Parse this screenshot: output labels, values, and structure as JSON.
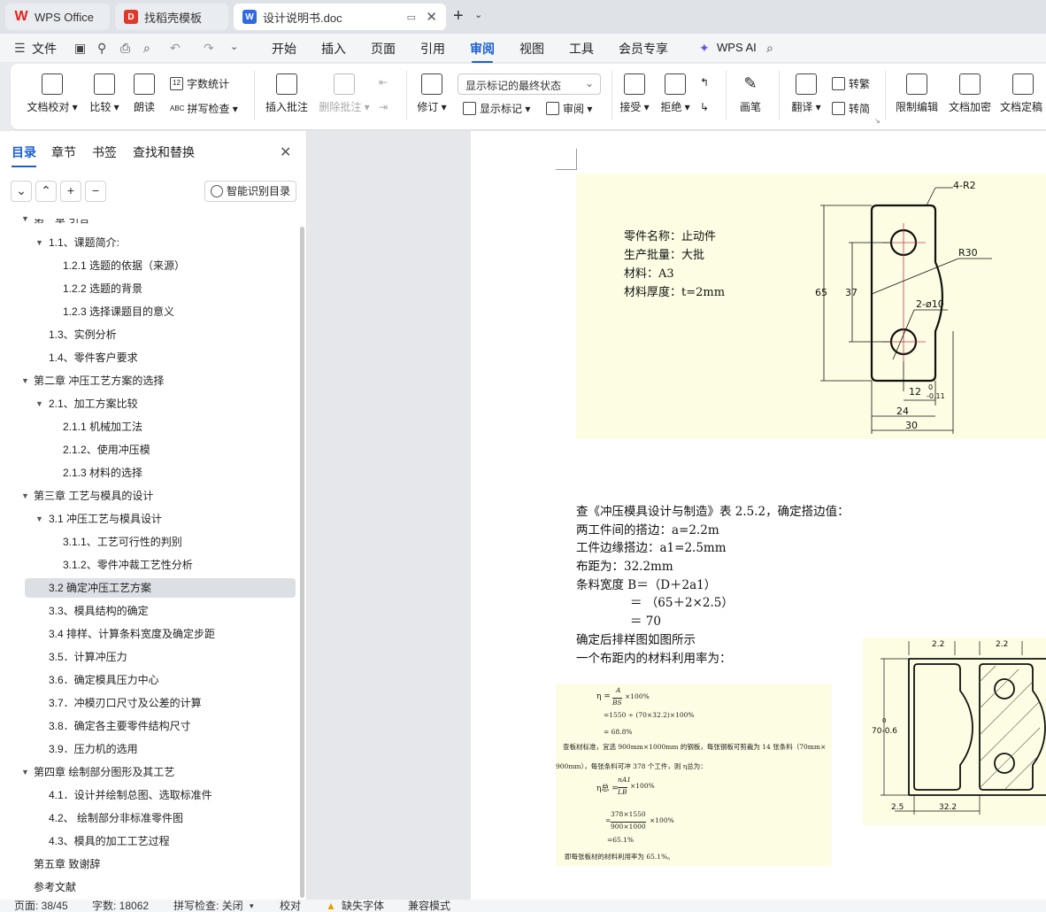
{
  "tabs": {
    "wps": "WPS Office",
    "template": "找稻壳模板",
    "doc": "设计说明书.doc"
  },
  "menu": {
    "file": "文件",
    "items": [
      "开始",
      "插入",
      "页面",
      "引用",
      "审阅",
      "视图",
      "工具",
      "会员专享"
    ],
    "active": "审阅",
    "ai": "WPS AI"
  },
  "ribbon": {
    "doc_check": "文档校对",
    "compare": "比较",
    "read_aloud": "朗读",
    "word_count": "字数统计",
    "spell_check": "拼写检查",
    "insert_comment": "插入批注",
    "delete_comment": "删除批注",
    "revise": "修订",
    "markup_select": "显示标记的最终状态",
    "show_markup": "显示标记",
    "review": "审阅",
    "accept": "接受",
    "reject": "拒绝",
    "pen": "画笔",
    "translate": "翻译",
    "to_traditional": "转繁",
    "to_simplified": "转简",
    "restrict_edit": "限制编辑",
    "doc_encrypt": "文档加密",
    "doc_finalize": "文档定稿"
  },
  "panel": {
    "tabs": [
      "目录",
      "章节",
      "书签",
      "查找和替换"
    ],
    "smart_toc": "智能识别目录",
    "toc": [
      {
        "text": "第一章    引言",
        "level": 0,
        "toggle": true,
        "cut": true
      },
      {
        "text": "1.1、课题简介:",
        "level": 1,
        "toggle": true
      },
      {
        "text": "1.2.1 选题的依据（来源）",
        "level": 2
      },
      {
        "text": "1.2.2 选题的背景",
        "level": 2
      },
      {
        "text": "1.2.3 选择课题目的意义",
        "level": 2
      },
      {
        "text": "1.3、实例分析",
        "level": 1
      },
      {
        "text": "1.4、零件客户要求",
        "level": 1
      },
      {
        "text": "第二章   冲压工艺方案的选择",
        "level": 0,
        "toggle": true
      },
      {
        "text": "2.1、加工方案比较",
        "level": 1,
        "toggle": true
      },
      {
        "text": "2.1.1 机械加工法",
        "level": 2
      },
      {
        "text": "2.1.2、使用冲压模",
        "level": 2
      },
      {
        "text": "2.1.3 材料的选择",
        "level": 2
      },
      {
        "text": "第三章  工艺与模具的设计",
        "level": 0,
        "toggle": true
      },
      {
        "text": "3.1 冲压工艺与模具设计",
        "level": 1,
        "toggle": true
      },
      {
        "text": "3.1.1、工艺可行性的判别",
        "level": 2
      },
      {
        "text": "3.1.2、零件冲裁工艺性分析",
        "level": 2
      },
      {
        "text": "3.2 确定冲压工艺方案",
        "level": 1,
        "selected": true
      },
      {
        "text": "3.3、模具结构的确定",
        "level": 1
      },
      {
        "text": " 3.4 排样、计算条料宽度及确定步距",
        "level": 1
      },
      {
        "text": "3.5．计算冲压力",
        "level": 1
      },
      {
        "text": "3.6．确定模具压力中心",
        "level": 1
      },
      {
        "text": "3.7．冲模刃口尺寸及公差的计算",
        "level": 1
      },
      {
        "text": "3.8．确定各主要零件结构尺寸",
        "level": 1
      },
      {
        "text": "3.9．压力机的选用",
        "level": 1
      },
      {
        "text": "第四章  绘制部分图形及其工艺",
        "level": 0,
        "toggle": true
      },
      {
        "text": "4.1．设计并绘制总图、选取标准件",
        "level": 1
      },
      {
        "text": "4.2、  绘制部分非标准零件图",
        "level": 1
      },
      {
        "text": "4.3、模具的加工工艺过程",
        "level": 1
      },
      {
        "text": "第五章  致谢辞",
        "level": 0
      },
      {
        "text": "参考文献",
        "level": 0
      }
    ]
  },
  "document": {
    "fig1": {
      "labels": [
        "零件名称：止动件",
        "生产批量：大批",
        "材料：A3",
        "材料厚度：t=2mm"
      ],
      "dims": {
        "r2": "4-R2",
        "r30": "R30",
        "hole": "2-ø10",
        "d65": "65",
        "d37": "37",
        "d12": "12",
        "tol_up": "0",
        "tol_dn": "-0.11",
        "d24": "24",
        "d30": "30"
      }
    },
    "lines": [
      "查《冲压模具设计与制造》表 2.5.2，确定搭边值：",
      "两工件间的搭边：a=2.2m",
      "工件边缘搭边：a1=2.5mm",
      "布距为：32.2mm",
      "条料宽度 B＝（D＋2a1）",
      "＝ （65＋2×2.5）",
      "＝ 70",
      "确定后排样图如图所示",
      "一个布距内的材料利用率为："
    ],
    "fig2": {
      "eta": "η =",
      "frac1_num": "A",
      "frac1_den": "BS",
      "pct1": "×100%",
      "line2": "=1550 ÷ (70×32.2)×100%",
      "line3": "= 68.8%",
      "line4": "查板材标准，宜选 900mm×1000mm 的钢板，每张钢板可剪裁为 14 张条料（70mm×",
      "line5": "900mm），每张条料可冲 378 个工件，则 η总为：",
      "eta2": "η总 =",
      "frac2_num": "nA1",
      "frac2_den": "LB",
      "pct2": "×100%",
      "frac3_num": "378×1550",
      "frac3_den": "900×1000",
      "line7": "=65.1%",
      "line8": "即每张板材的材料利用率为 65.1%。"
    },
    "fig3": {
      "d22a": "2.2",
      "d22b": "2.2",
      "tol_w": "0",
      "d70": "70-0.6",
      "d25": "2.5",
      "d322": "32.2"
    }
  },
  "status": {
    "page": "页面: 38/45",
    "words": "字数: 18062",
    "spell": "拼写检查: 关闭",
    "proof": "校对",
    "missing_font": "缺失字体",
    "compat": "兼容模式"
  }
}
